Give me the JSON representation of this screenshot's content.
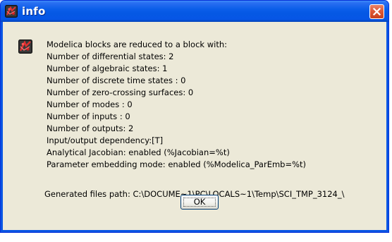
{
  "window": {
    "title": "info",
    "title_icon": "scilab-app-icon",
    "close_icon": "close-x-icon",
    "colors": {
      "titlebar": "#0558e4",
      "close_button": "#de5a37",
      "client": "#ece9d8"
    }
  },
  "message": {
    "icon": "scilab-app-icon",
    "lines": [
      "Modelica blocks are reduced to a block with:",
      "Number of differential states: 2",
      "Number of algebraic states: 1",
      "Number of discrete time states  : 0",
      "Number of zero-crossing surfaces: 0",
      "Number of modes  : 0",
      "Number of inputs : 0",
      "Number of outputs: 2",
      "Input/output dependency:[T]",
      "Analytical Jacobian: enabled  (%Jacobian=%t)",
      "Parameter embedding mode: enabled (%Modelica_ParEmb=%t)"
    ],
    "path_line": "Generated files path: C:\\DOCUME~1\\PC\\LOCALS~1\\Temp\\SCI_TMP_3124_\\"
  },
  "buttons": {
    "ok_label": "OK"
  }
}
